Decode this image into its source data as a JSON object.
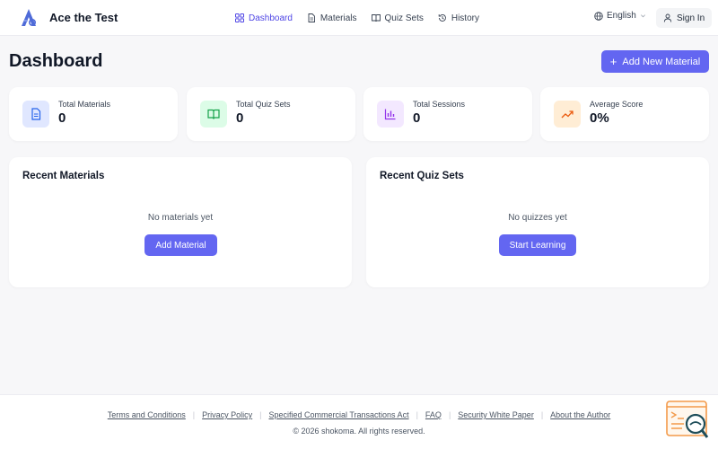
{
  "header": {
    "brand": "Ace the Test",
    "nav": [
      {
        "label": "Dashboard",
        "icon": "grid-icon",
        "active": true
      },
      {
        "label": "Materials",
        "icon": "document-icon"
      },
      {
        "label": "Quiz Sets",
        "icon": "book-icon"
      },
      {
        "label": "History",
        "icon": "history-icon"
      }
    ],
    "language": "English",
    "sign_in": "Sign In"
  },
  "page": {
    "title": "Dashboard",
    "add_new": "Add New Material"
  },
  "stats": [
    {
      "label": "Total Materials",
      "value": "0",
      "icon": "document-icon",
      "color": "#2563eb",
      "bg": "#e0e7ff"
    },
    {
      "label": "Total Quiz Sets",
      "value": "0",
      "icon": "book-open-icon",
      "color": "#16a34a",
      "bg": "#dcfce7"
    },
    {
      "label": "Total Sessions",
      "value": "0",
      "icon": "bar-chart-icon",
      "color": "#9333ea",
      "bg": "#f3e8ff"
    },
    {
      "label": "Average Score",
      "value": "0%",
      "icon": "trending-up-icon",
      "color": "#ea580c",
      "bg": "#ffedd5"
    }
  ],
  "recent_materials": {
    "title": "Recent Materials",
    "empty": "No materials yet",
    "button": "Add Material"
  },
  "recent_quiz_sets": {
    "title": "Recent Quiz Sets",
    "empty": "No quizzes yet",
    "button": "Start Learning"
  },
  "footer": {
    "links": [
      "Terms and Conditions",
      "Privacy Policy",
      "Specified Commercial Transactions Act",
      "FAQ",
      "Security White Paper",
      "About the Author"
    ],
    "copyright": "© 2026 shokoma. All rights reserved."
  },
  "colors": {
    "accent": "#6366f1",
    "nav_active": "#4f46e5"
  }
}
